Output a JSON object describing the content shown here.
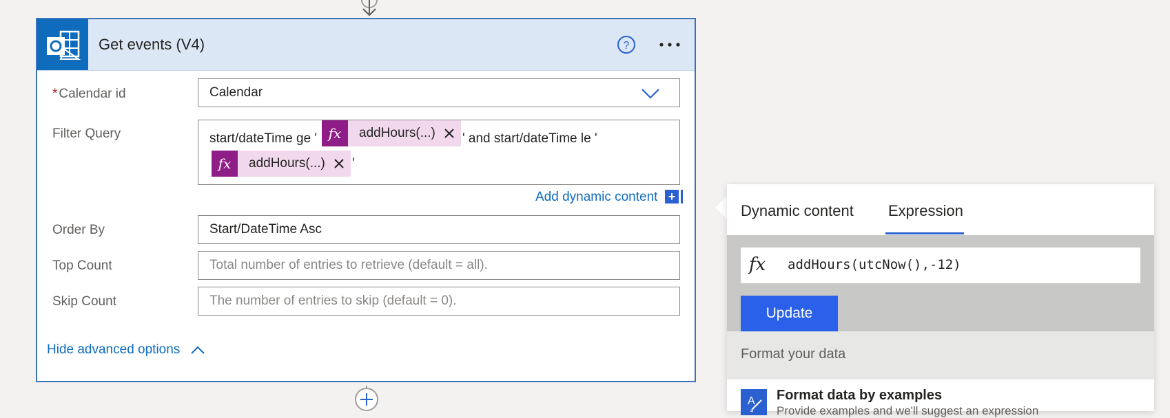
{
  "card": {
    "title": "Get events (V4)",
    "app_icon": "outlook-icon",
    "help_icon": "help-circle-icon",
    "more_icon": "ellipsis-icon"
  },
  "fields": {
    "calendar_id": {
      "label": "Calendar id",
      "required_mark": "*",
      "value": "Calendar"
    },
    "filter_query": {
      "label": "Filter Query",
      "text_1": "start/dateTime ge '",
      "token_1": "addHours(...)",
      "text_2": "' and start/dateTime le '",
      "token_2": "addHours(...)",
      "text_3": "'"
    },
    "add_dynamic_content": "Add dynamic content",
    "add_dynamic_plus": "+",
    "order_by": {
      "label": "Order By",
      "value": "Start/DateTime Asc"
    },
    "top_count": {
      "label": "Top Count",
      "placeholder": "Total number of entries to retrieve (default = all)."
    },
    "skip_count": {
      "label": "Skip Count",
      "placeholder": "The number of entries to skip (default = 0)."
    },
    "hide_advanced": "Hide advanced options"
  },
  "panel": {
    "tabs": [
      {
        "label": "Dynamic content",
        "active": false
      },
      {
        "label": "Expression",
        "active": true
      }
    ],
    "fx_symbol": "fx",
    "expression": "addHours(utcNow(),-12)",
    "update_label": "Update",
    "format_title": "Format your data",
    "format_by_examples_title": "Format data by examples",
    "format_by_examples_desc": "Provide examples and we'll suggest an expression"
  },
  "colors": {
    "accent": "#2b60ea",
    "card_border": "#3b73b9",
    "header_bg": "#dce7f5",
    "token_fx": "#8f1d87",
    "token_bg": "#f1d8ec"
  }
}
